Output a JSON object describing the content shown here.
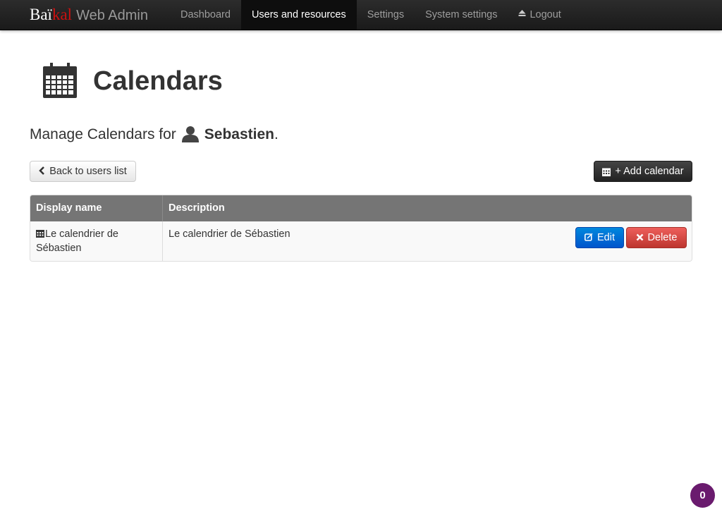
{
  "brand": {
    "part1": "Baï",
    "part2": "kal",
    "part3": "Web Admin"
  },
  "nav": {
    "items": [
      {
        "label": "Dashboard",
        "active": false
      },
      {
        "label": "Users and resources",
        "active": true
      },
      {
        "label": "Settings",
        "active": false
      },
      {
        "label": "System settings",
        "active": false
      },
      {
        "label": "Logout",
        "active": false,
        "icon": "eject-icon"
      }
    ]
  },
  "page": {
    "title": "Calendars",
    "icon": "calendar-icon",
    "subtitle_prefix": "Manage Calendars for",
    "username": "Sebastien",
    "subtitle_suffix": "."
  },
  "actions": {
    "back_label": "Back to users list",
    "back_icon": "chevron-left-icon",
    "add_label": "+ Add calendar",
    "add_icon": "calendar-icon"
  },
  "table": {
    "headers": [
      "Display name",
      "Description"
    ],
    "rows": [
      {
        "display_name_line1": "Le calendrier de",
        "display_name_line2": "Sébastien",
        "description": "Le calendrier de Sébastien",
        "edit_label": "Edit",
        "delete_label": "Delete"
      }
    ]
  },
  "badge": {
    "count": "0"
  },
  "colors": {
    "navbar": "#1b1b1b",
    "brand_accent": "#cc1111",
    "edit": "#0066cc",
    "delete": "#da4f49",
    "add": "#333333",
    "table_header": "#757575",
    "badge": "#6a1b6e"
  }
}
